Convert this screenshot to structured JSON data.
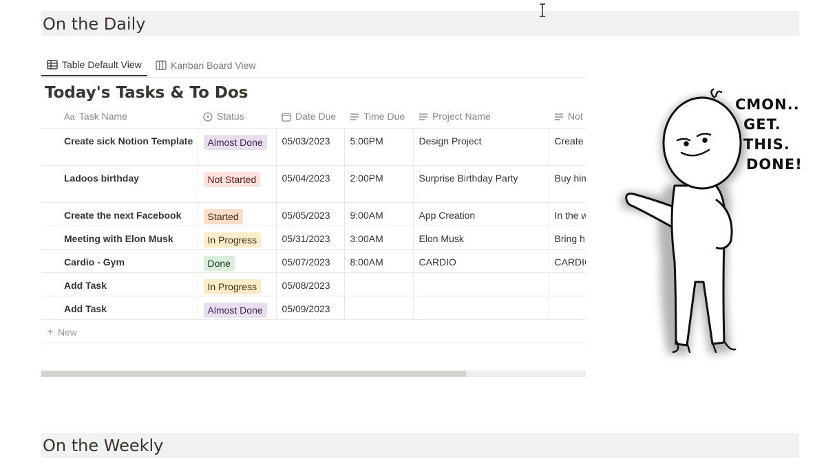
{
  "page": {
    "heading_daily": "On the Daily",
    "heading_weekly": "On the Weekly"
  },
  "views": {
    "tabs": [
      {
        "label": "Table Default View",
        "icon": "table-icon",
        "active": true
      },
      {
        "label": "Kanban Board View",
        "icon": "board-icon",
        "active": false
      }
    ]
  },
  "database": {
    "title": "Today's Tasks & To Dos",
    "columns": [
      {
        "label": "Task Name",
        "icon": "text-aa-icon"
      },
      {
        "label": "Status",
        "icon": "status-icon"
      },
      {
        "label": "Date Due",
        "icon": "calendar-icon"
      },
      {
        "label": "Time Due",
        "icon": "text-lines-icon"
      },
      {
        "label": "Project Name",
        "icon": "text-lines-icon"
      },
      {
        "label": "Not",
        "icon": "text-lines-icon"
      }
    ],
    "rows": [
      {
        "name": "Create sick Notion Template",
        "status": "Almost Done",
        "date": "05/03/2023",
        "time": "5:00PM",
        "project": "Design Project",
        "notes": "Create a like no"
      },
      {
        "name": "Ladoos birthday",
        "status": "Not Started",
        "date": "05/04/2023",
        "time": "2:00PM",
        "project": "Surprise Birthday Party",
        "notes": "Buy him card"
      },
      {
        "name": "Create the next Facebook",
        "status": "Started",
        "date": "05/05/2023",
        "time": "9:00AM",
        "project": "App Creation",
        "notes": "In the w"
      },
      {
        "name": "Meeting with Elon Musk",
        "status": "In Progress",
        "date": "05/31/2023",
        "time": "3:00AM",
        "project": "Elon Musk",
        "notes": "Bring h"
      },
      {
        "name": "Cardio - Gym",
        "status": "Done",
        "date": "05/07/2023",
        "time": "8:00AM",
        "project": "CARDIO",
        "notes": "CARDIO"
      },
      {
        "name": "Add Task",
        "status": "In Progress",
        "date": "05/08/2023",
        "time": "",
        "project": "",
        "notes": ""
      },
      {
        "name": "Add Task",
        "status": "Almost Done",
        "date": "05/09/2023",
        "time": "",
        "project": "",
        "notes": ""
      }
    ],
    "new_row_label": "New",
    "status_colors": {
      "Almost Done": {
        "bg": "#e8deee",
        "fg": "#412454"
      },
      "Not Started": {
        "bg": "#ffe2dd",
        "fg": "#5d1715"
      },
      "Started": {
        "bg": "#fadec9",
        "fg": "#49290e"
      },
      "In Progress": {
        "bg": "#fdecc8",
        "fg": "#402c1b"
      },
      "Done": {
        "bg": "#dbeddb",
        "fg": "#1c3829"
      }
    },
    "horizontal_scroll_fraction": 0.78
  },
  "illustration": {
    "speech_lines": [
      "CMON..",
      "GET.",
      "THIS.",
      "DONE!"
    ]
  }
}
